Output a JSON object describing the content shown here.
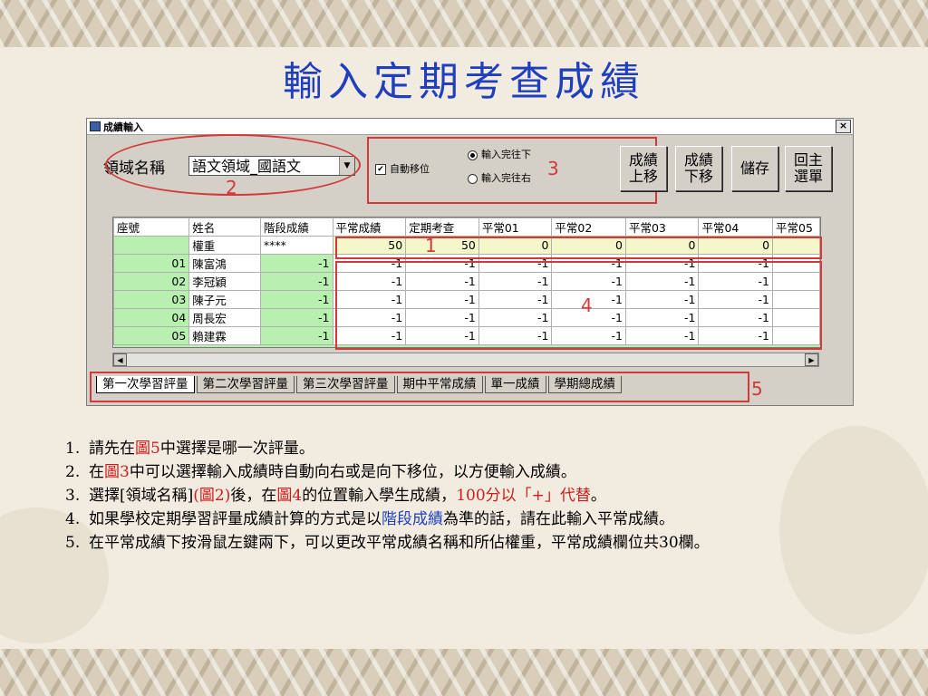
{
  "page": {
    "title": "輸入定期考查成績"
  },
  "window": {
    "title": "成績輸入",
    "close_label": "×",
    "domain_label": "領域名稱",
    "domain_select": {
      "value": "語文領域_國語文",
      "arrow": "▼"
    },
    "auto_move": {
      "label": "自動移位",
      "checked": true,
      "mark": "✔"
    },
    "radio_down": {
      "label": "輸入完往下",
      "selected": true
    },
    "radio_right": {
      "label": "輸入完往右",
      "selected": false
    },
    "buttons": {
      "move_up": "成績\n上移",
      "move_down": "成績\n下移",
      "save": "儲存",
      "main_menu": "回主\n選單"
    },
    "grid": {
      "columns": [
        "座號",
        "姓名",
        "階段成績",
        "平常成績",
        "定期考查",
        "平常01",
        "平常02",
        "平常03",
        "平常04",
        "平常05"
      ],
      "weight_row": {
        "label": "權重",
        "stage": "****",
        "values": [
          "50",
          "50",
          "0",
          "0",
          "0",
          "0",
          ""
        ]
      },
      "rows": [
        {
          "seat": "01",
          "name": "陳富鴻",
          "stage": "-1",
          "values": [
            "-1",
            "-1",
            "-1",
            "-1",
            "-1",
            "-1",
            ""
          ]
        },
        {
          "seat": "02",
          "name": "李冠穎",
          "stage": "-1",
          "values": [
            "-1",
            "-1",
            "-1",
            "-1",
            "-1",
            "-1",
            ""
          ]
        },
        {
          "seat": "03",
          "name": "陳子元",
          "stage": "-1",
          "values": [
            "-1",
            "-1",
            "-1",
            "-1",
            "-1",
            "-1",
            ""
          ]
        },
        {
          "seat": "04",
          "name": "周長宏",
          "stage": "-1",
          "values": [
            "-1",
            "-1",
            "-1",
            "-1",
            "-1",
            "-1",
            ""
          ]
        },
        {
          "seat": "05",
          "name": "賴建霖",
          "stage": "-1",
          "values": [
            "-1",
            "-1",
            "-1",
            "-1",
            "-1",
            "-1",
            ""
          ]
        }
      ]
    },
    "scroll": {
      "left": "◀",
      "right": "▶"
    },
    "tabs": [
      "第一次學習評量",
      "第二次學習評量",
      "第三次學習評量",
      "期中平常成績",
      "單一成績",
      "學期總成績"
    ]
  },
  "annotations": {
    "n1": "1",
    "n2": "2",
    "n3": "3",
    "n4": "4",
    "n5": "5"
  },
  "notes": [
    {
      "idx": "1.",
      "parts": [
        {
          "t": "請先在"
        },
        {
          "t": "圖5",
          "c": "red"
        },
        {
          "t": "中選擇是哪一次評量。"
        }
      ]
    },
    {
      "idx": "2.",
      "parts": [
        {
          "t": "在"
        },
        {
          "t": "圖3",
          "c": "red"
        },
        {
          "t": "中可以選擇輸入成績時自動向右或是向下移位，以方便輸入成績。"
        }
      ]
    },
    {
      "idx": "3.",
      "parts": [
        {
          "t": "選擇[領域名稱]"
        },
        {
          "t": "(圖2)",
          "c": "red"
        },
        {
          "t": "後，在"
        },
        {
          "t": "圖4",
          "c": "red"
        },
        {
          "t": "的位置輸入學生成績，"
        },
        {
          "t": "100分以「+」代替",
          "c": "red"
        },
        {
          "t": "。"
        }
      ]
    },
    {
      "idx": "4.",
      "parts": [
        {
          "t": "如果學校定期學習評量成績計算的方式是以"
        },
        {
          "t": "階段成績",
          "c": "blue"
        },
        {
          "t": "為準的話，請在此輸入平常成績。"
        }
      ]
    },
    {
      "idx": "5.",
      "parts": [
        {
          "t": "在平常成績下按滑鼠左鍵兩下，可以更改平常成績名稱和所佔權重，平常成績欄位共30欄。"
        }
      ]
    }
  ]
}
